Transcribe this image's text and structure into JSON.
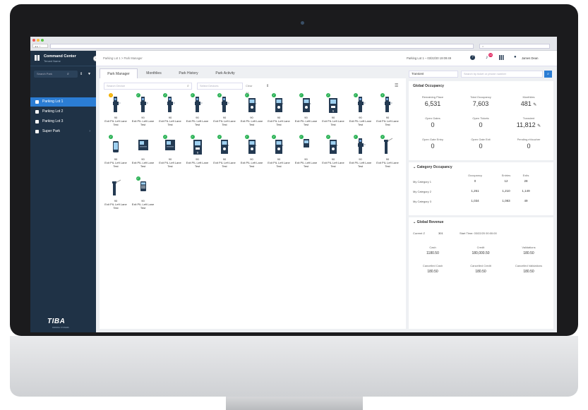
{
  "browser": {
    "nav": "◂ ▸ +",
    "address": "",
    "secondary": "⌕"
  },
  "sidebar": {
    "title": "Command Center",
    "subtitle": "Tenant Name",
    "search_placeholder": "Search Park",
    "items": [
      {
        "label": "Parking Lot 1",
        "active": true
      },
      {
        "label": "Parking Lot 2",
        "active": false
      },
      {
        "label": "Parking Lot 3",
        "active": false
      },
      {
        "label": "Super Park",
        "active": false
      }
    ],
    "logo_text": "TIBA",
    "logo_sub": "PARKING SYSTEMS"
  },
  "topbar": {
    "breadcrumb": "Parking Lot 1 > Park Manager",
    "datetime": "Parking Lot 1 – 03/22/20  19:09:49",
    "notification_count": "10",
    "user_name": "James Dean"
  },
  "tabs": [
    "Park Manager",
    "Monthlies",
    "Park History",
    "Park Activity"
  ],
  "device_toolbar": {
    "search_placeholder": "Search Device",
    "select_placeholder": "Select Devices",
    "clear_all": "Clear All"
  },
  "devices": [
    {
      "value": "90",
      "label": "Exit PIL Left Lane Test",
      "type": "exit",
      "status": "warn"
    },
    {
      "value": "90",
      "label": "Exit PIL Left Lane Test",
      "type": "exit",
      "status": "ok"
    },
    {
      "value": "90",
      "label": "Exit PIL Left Lane Test",
      "type": "exit",
      "status": "ok"
    },
    {
      "value": "90",
      "label": "Exit PIL Left Lane Test",
      "type": "exit",
      "status": "ok"
    },
    {
      "value": "90",
      "label": "Exit PIL Left Lane Test",
      "type": "exit",
      "status": "ok"
    },
    {
      "value": "90",
      "label": "Exit PIL Left Lane Test",
      "type": "kiosk",
      "status": "ok"
    },
    {
      "value": "90",
      "label": "Exit PIL Left Lane Test",
      "type": "kiosk",
      "status": "ok"
    },
    {
      "value": "90",
      "label": "Exit PIL Left Lane Test",
      "type": "kiosk",
      "status": "ok"
    },
    {
      "value": "90",
      "label": "Exit PIL Left Lane Test",
      "type": "payst",
      "status": "ok"
    },
    {
      "value": "90",
      "label": "Exit PIL Left Lane Test",
      "type": "exit",
      "status": "ok"
    },
    {
      "value": "90",
      "label": "Exit PIL Left Lane Test",
      "type": "exit",
      "status": "ok"
    },
    {
      "value": "90",
      "label": "Exit PIL Left Lane Test",
      "type": "phone",
      "status": "ok"
    },
    {
      "value": "90",
      "label": "Exit PIL Left Lane Test",
      "type": "box",
      "status": "none"
    },
    {
      "value": "90",
      "label": "Exit PIL Left Lane Test",
      "type": "box",
      "status": "ok"
    },
    {
      "value": "90",
      "label": "Exit PIL Left Lane Test",
      "type": "payst",
      "status": "ok"
    },
    {
      "value": "90",
      "label": "Exit PIL Left Lane Test",
      "type": "kiosk",
      "status": "ok"
    },
    {
      "value": "90",
      "label": "Exit PIL Left Lane Test",
      "type": "kiosk",
      "status": "ok"
    },
    {
      "value": "90",
      "label": "Exit PIL Left Lane Test",
      "type": "kiosk",
      "status": "ok"
    },
    {
      "value": "90",
      "label": "Exit PIL Left Lane Test",
      "type": "small",
      "status": "ok"
    },
    {
      "value": "90",
      "label": "Exit PIL Left Lane Test",
      "type": "kiosk",
      "status": "ok"
    },
    {
      "value": "90",
      "label": "Exit PIL Left Lane Test",
      "type": "exit",
      "status": "ok"
    },
    {
      "value": "90",
      "label": "Exit PIL Left Lane Test",
      "type": "barrier",
      "status": "ok"
    },
    {
      "value": "90",
      "label": "Exit PIL Left Lane Test",
      "type": "barrier",
      "status": "none"
    },
    {
      "value": "90",
      "label": "Exit PIL Left Lane Test",
      "type": "calc",
      "status": "ok"
    }
  ],
  "right": {
    "sale_select": "Transient",
    "sale_search_placeholder": "Search by ticket or phone number",
    "global_occupancy": {
      "title": "Global Occupancy",
      "stats": [
        {
          "label": "Remaining Place",
          "value": "6,531",
          "edit": false
        },
        {
          "label": "Total Occupancy",
          "value": "7,603",
          "edit": false
        },
        {
          "label": "Monthlies",
          "value": "481",
          "edit": true
        },
        {
          "label": "Open Gates",
          "value": "0",
          "edit": false
        },
        {
          "label": "Open Tickets",
          "value": "0",
          "edit": false
        },
        {
          "label": "Transient",
          "value": "11,812",
          "edit": true
        },
        {
          "label": "Open Gate Entry",
          "value": "0",
          "edit": false
        },
        {
          "label": "Open Gate Exit",
          "value": "0",
          "edit": false
        },
        {
          "label": "Pending eVoucher",
          "value": "0",
          "edit": false
        }
      ]
    },
    "category_occupancy": {
      "title": "Category Occupancy",
      "headers": [
        "Occupancy",
        "Entries",
        "Exits"
      ],
      "rows": [
        {
          "name": "My Category 1",
          "occupancy": "0",
          "entries": "12",
          "exits": "28"
        },
        {
          "name": "My Category 2",
          "occupancy": "1,261",
          "entries": "1,210",
          "exits": "1,149"
        },
        {
          "name": "My Category 3",
          "occupancy": "1,034",
          "entries": "1,083",
          "exits": "49"
        }
      ]
    },
    "global_revenue": {
      "title": "Global Revenue",
      "current_label": "Current Z",
      "current_value": "301",
      "start_time": "Start Time: 03/22/20  00:00:00",
      "items": [
        {
          "label": "Cash",
          "value": "1180.50"
        },
        {
          "label": "Credit",
          "value": "180,000.50"
        },
        {
          "label": "Validations",
          "value": "180.50"
        },
        {
          "label": "Cancelled Cash",
          "value": "180.50"
        },
        {
          "label": "Cancelled Credit",
          "value": "180.50"
        },
        {
          "label": "Cancelled Validations",
          "value": "180.50"
        }
      ]
    }
  },
  "colors": {
    "sidebar": "#1f3246",
    "accent": "#2b7dd4",
    "ok": "#2db357",
    "warn": "#f2b000",
    "device": "#243a52"
  }
}
